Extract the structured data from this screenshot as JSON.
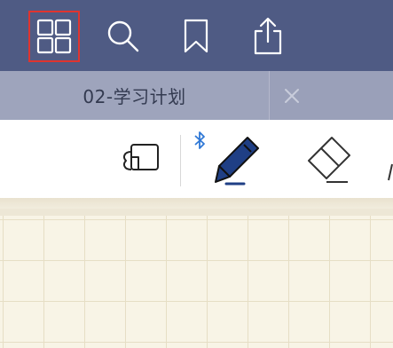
{
  "topbar": {
    "buttons": [
      {
        "icon": "grid-icon",
        "selected": true
      },
      {
        "icon": "search-icon",
        "selected": false
      },
      {
        "icon": "bookmark-icon",
        "selected": false
      },
      {
        "icon": "share-icon",
        "selected": false
      }
    ],
    "background": "#4f5b84",
    "selected_outline": "#e0342f"
  },
  "tabs": [
    {
      "label": "02-学习计划",
      "active": true
    }
  ],
  "tab_close_icon": "close-icon",
  "toolbar": {
    "tools": [
      "lasso-icon",
      "bluetooth-icon",
      "pen-icon",
      "eraser-icon"
    ],
    "pen_color": "#1f3f85"
  },
  "paper": {
    "pattern": "grid",
    "color": "#f8f4e6",
    "line_color": "#e6dec5"
  }
}
